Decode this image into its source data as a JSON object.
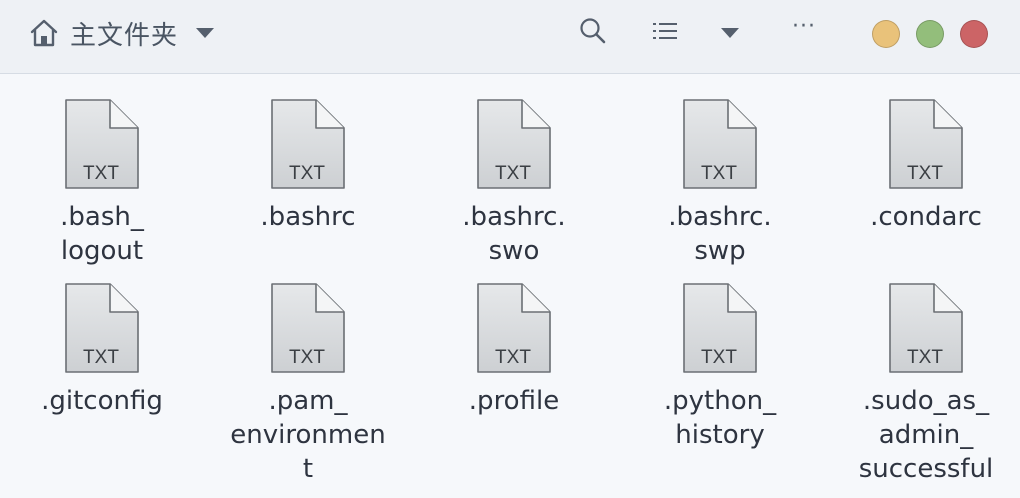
{
  "header": {
    "location_label": "主文件夹",
    "more_label": "···"
  },
  "colors": {
    "header_bg": "#eef1f5",
    "content_bg": "#f6f8fb",
    "minimize": "#e9c27a",
    "maximize": "#93be7b",
    "close": "#cc6466"
  },
  "files": [
    {
      "name": ".bash_\nlogout",
      "type_label": "TXT"
    },
    {
      "name": ".bashrc",
      "type_label": "TXT"
    },
    {
      "name": ".bashrc.\nswo",
      "type_label": "TXT"
    },
    {
      "name": ".bashrc.\nswp",
      "type_label": "TXT"
    },
    {
      "name": ".condarc",
      "type_label": "TXT"
    },
    {
      "name": ".gitconfig",
      "type_label": "TXT"
    },
    {
      "name": ".pam_\nenvironmen\nt",
      "type_label": "TXT"
    },
    {
      "name": ".profile",
      "type_label": "TXT"
    },
    {
      "name": ".python_\nhistory",
      "type_label": "TXT"
    },
    {
      "name": ".sudo_as_\nadmin_\nsuccessful",
      "type_label": "TXT"
    }
  ]
}
